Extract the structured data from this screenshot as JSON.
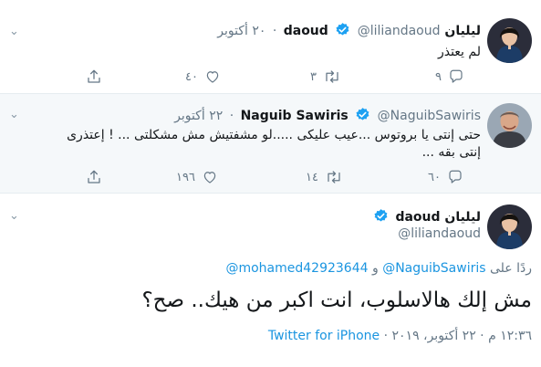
{
  "tweets": [
    {
      "name": "ليليان daoud",
      "handle": "@liliandaoud",
      "date": "٢٠ أكتوبر",
      "text": "لم يعتذر",
      "reply_count": "٩",
      "retweet_count": "٣",
      "like_count": "٤٠"
    },
    {
      "name": "Naguib Sawiris",
      "handle": "@NaguibSawiris",
      "date": "٢٢ أكتوبر",
      "text_line1": "حتى إنتى يا بروتوس ...عيب عليكى .....لو مشفتيش مش مشكلتى ... ! إعتذرى",
      "text_line2": "إنتى بقه ...",
      "reply_count": "٦٠",
      "retweet_count": "١٤",
      "like_count": "١٩٦"
    }
  ],
  "focused": {
    "name": "ليليان daoud",
    "handle": "@liliandaoud",
    "replying_prefix": "ردًا على",
    "replying_user1": "@NaguibSawiris",
    "replying_and": "و",
    "replying_user2": "@mohamed42923644",
    "text": "مش إلك هالاسلوب، انت اكبر من هيك.. صح؟",
    "time": "١٢:٣٦ م",
    "date": "٢٢ أكتوبر، ٢٠١٩",
    "source": "Twitter for iPhone"
  },
  "colors": {
    "verified": "#1da1f2",
    "link": "#1b95e0",
    "muted": "#657786"
  }
}
